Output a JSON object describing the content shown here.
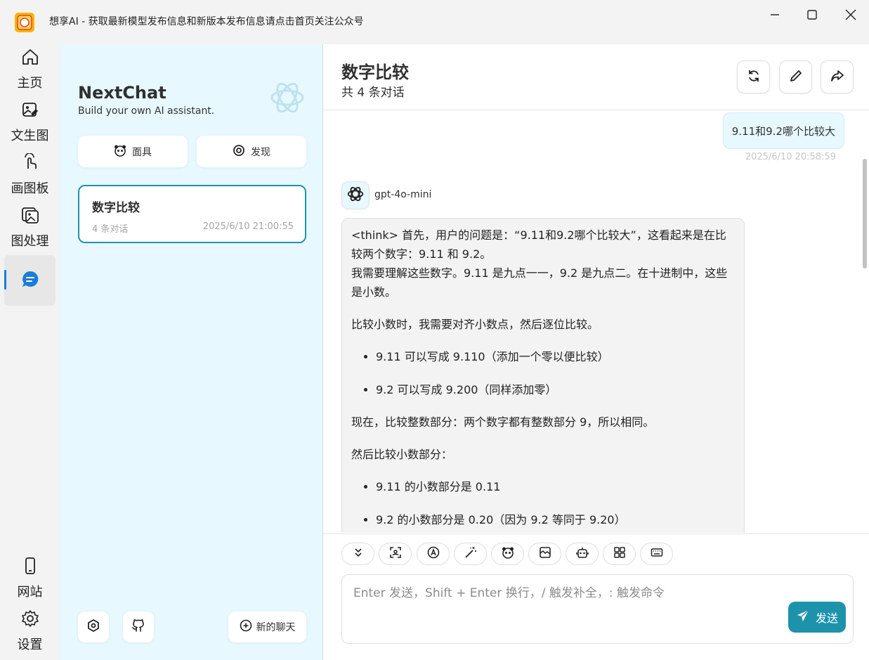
{
  "window": {
    "title": "想享AI  -  获取最新模型发布信息和新版本发布信息请点击首页关注公众号"
  },
  "nav": {
    "items": [
      {
        "label": "主页",
        "icon": "home-icon"
      },
      {
        "label": "文生图",
        "icon": "image-edit-icon"
      },
      {
        "label": "画图板",
        "icon": "hand-pointer-icon"
      },
      {
        "label": "图处理",
        "icon": "images-icon"
      },
      {
        "label": "",
        "icon": "chat-icon"
      },
      {
        "label": "网站",
        "icon": "mobile-icon"
      },
      {
        "label": "设置",
        "icon": "gear-icon"
      }
    ]
  },
  "sidebar": {
    "title": "NextChat",
    "subtitle": "Build your own AI assistant.",
    "mask_label": "面具",
    "discover_label": "发现",
    "chats": [
      {
        "title": "数字比较",
        "count": "4 条对话",
        "date": "2025/6/10 21:00:55"
      }
    ],
    "new_chat_label": "新的聊天"
  },
  "chat": {
    "title": "数字比较",
    "subtitle": "共 4 条对话",
    "messages": {
      "user": {
        "text": "9.11和9.2哪个比较大",
        "time": "2025/6/10 20:58:59"
      },
      "bot": {
        "model": "gpt-4o-mini",
        "p1": "<think> 首先，用户的问题是：“9.11和9.2哪个比较大”，这看起来是在比较两个数字：9.11 和 9.2。",
        "p2": "我需要理解这些数字。9.11 是九点一一，9.2 是九点二。在十进制中，这些是小数。",
        "p3": "比较小数时，我需要对齐小数点，然后逐位比较。",
        "li1": "9.11 可以写成 9.110（添加一个零以便比较）",
        "li2": "9.2 可以写成 9.200（同样添加零）",
        "p4": "现在，比较整数部分：两个数字都有整数部分 9，所以相同。",
        "p5": "然后比较小数部分：",
        "li3": "9.11 的小数部分是 0.11",
        "li4": "9.2 的小数部分是 0.20（因为 9.2 等同于 9.20）"
      }
    },
    "input": {
      "placeholder": "Enter 发送，Shift + Enter 换行，/ 触发补全，: 触发命令",
      "send_label": "发送"
    },
    "colors": {
      "accent": "#1d93ab",
      "sidebar_bg": "#e7f8ff"
    }
  }
}
